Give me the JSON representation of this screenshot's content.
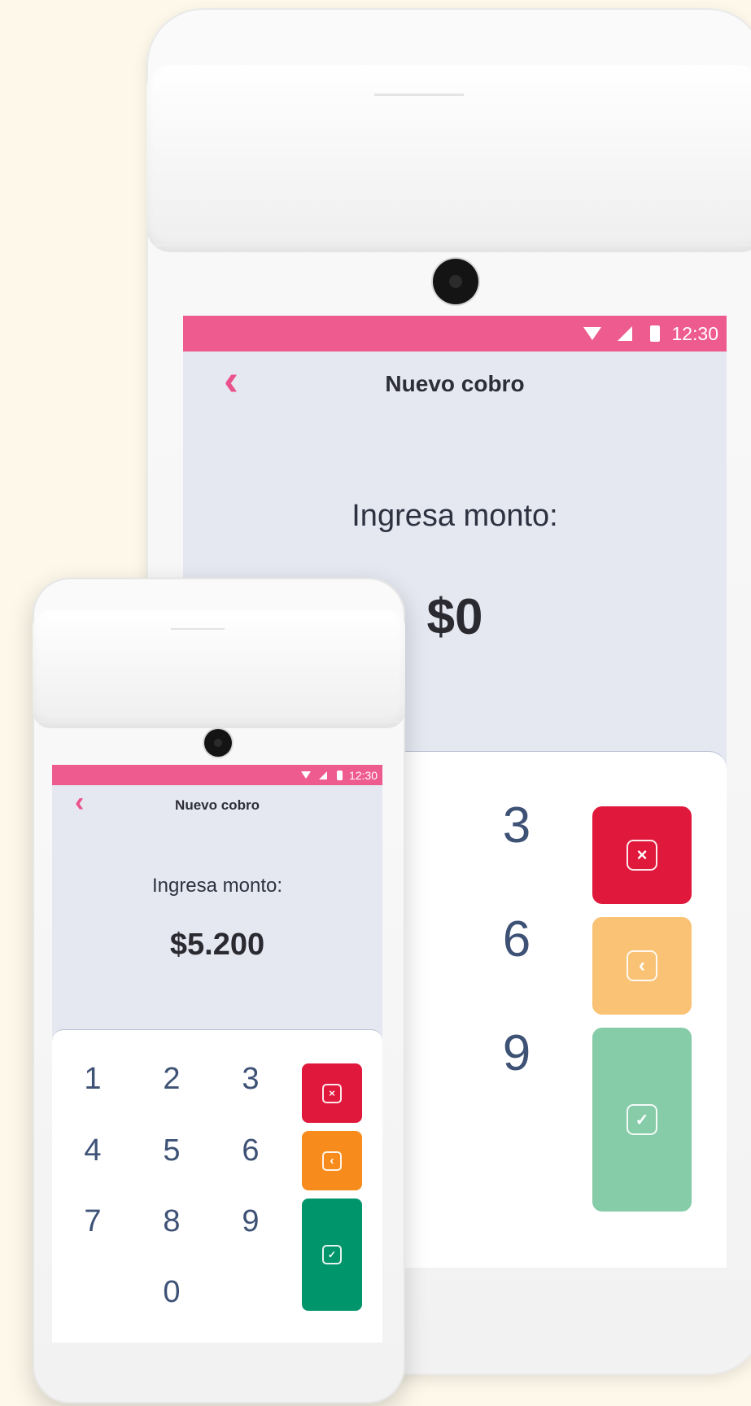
{
  "large_device": {
    "status": {
      "time": "12:30"
    },
    "header": {
      "back_glyph": "‹",
      "title": "Nuevo cobro"
    },
    "prompt": "Ingresa monto:",
    "amount": "$0",
    "keypad": {
      "keys": [
        "3",
        "6",
        "9"
      ]
    },
    "actions": {
      "cancel": {
        "glyph": "×",
        "color": "#e0193c"
      },
      "delete": {
        "glyph": "‹",
        "color": "#f9c275"
      },
      "confirm": {
        "glyph": "✓",
        "color": "#86cca8"
      }
    },
    "colors": {
      "statusbar": "#ee5b8f",
      "screen_bg": "#e5e7f1"
    }
  },
  "small_device": {
    "status": {
      "time": "12:30"
    },
    "header": {
      "back_glyph": "‹",
      "title": "Nuevo cobro"
    },
    "prompt": "Ingresa monto:",
    "amount": "$5.200",
    "keypad": {
      "keys": [
        "1",
        "2",
        "3",
        "4",
        "5",
        "6",
        "7",
        "8",
        "9",
        "0"
      ]
    },
    "actions": {
      "cancel": {
        "glyph": "×",
        "color": "#e0193c"
      },
      "delete": {
        "glyph": "‹",
        "color": "#f78b1b"
      },
      "confirm": {
        "glyph": "✓",
        "color": "#00956a"
      }
    },
    "colors": {
      "statusbar": "#ee5b8f",
      "screen_bg": "#e5e7f1"
    }
  }
}
